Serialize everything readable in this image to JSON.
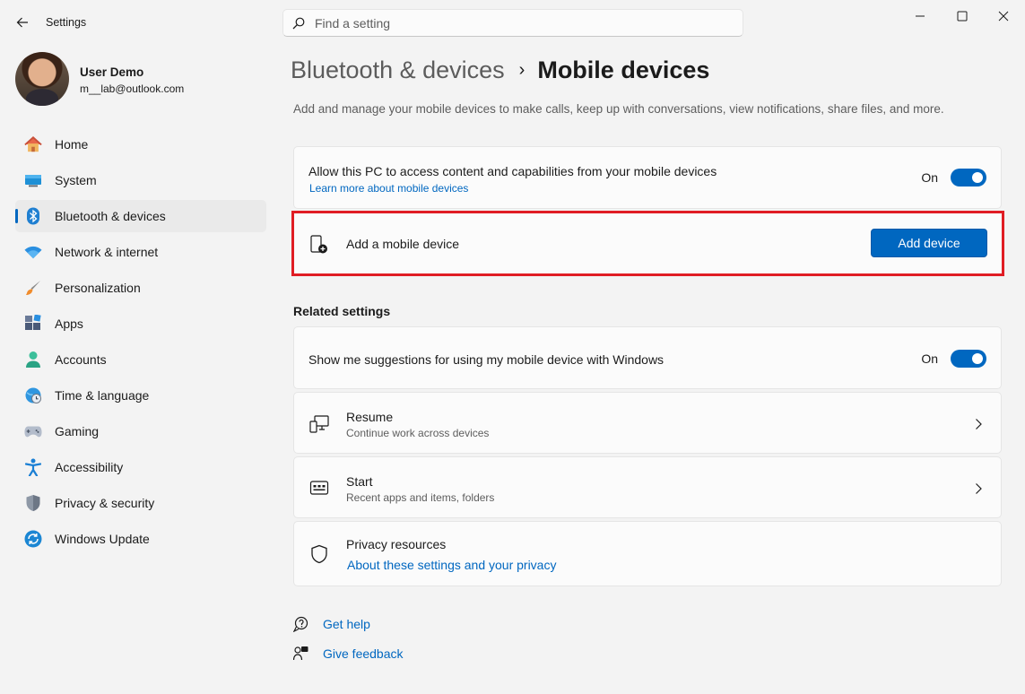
{
  "window": {
    "app_title": "Settings"
  },
  "search": {
    "placeholder": "Find a setting"
  },
  "profile": {
    "name": "User Demo",
    "email": "m__lab@outlook.com"
  },
  "sidebar": {
    "items": [
      {
        "label": "Home",
        "icon": "home-icon"
      },
      {
        "label": "System",
        "icon": "system-icon"
      },
      {
        "label": "Bluetooth & devices",
        "icon": "bluetooth-icon",
        "active": true
      },
      {
        "label": "Network & internet",
        "icon": "wifi-icon"
      },
      {
        "label": "Personalization",
        "icon": "brush-icon"
      },
      {
        "label": "Apps",
        "icon": "apps-icon"
      },
      {
        "label": "Accounts",
        "icon": "accounts-icon"
      },
      {
        "label": "Time & language",
        "icon": "globe-clock-icon"
      },
      {
        "label": "Gaming",
        "icon": "gamepad-icon"
      },
      {
        "label": "Accessibility",
        "icon": "accessibility-icon"
      },
      {
        "label": "Privacy & security",
        "icon": "shield-icon"
      },
      {
        "label": "Windows Update",
        "icon": "update-icon"
      }
    ]
  },
  "header": {
    "breadcrumb_parent": "Bluetooth & devices",
    "breadcrumb_separator": "›",
    "title": "Mobile devices",
    "description": "Add and manage your mobile devices to make calls, keep up with conversations, view notifications, share files, and more."
  },
  "main": {
    "access": {
      "title": "Allow this PC to access content and capabilities from your mobile devices",
      "link": "Learn more about mobile devices",
      "toggle_state": "On",
      "enabled": true
    },
    "add_device": {
      "title": "Add a mobile device",
      "button": "Add device"
    },
    "related_title": "Related settings",
    "suggestions": {
      "title": "Show me suggestions for using my mobile device with Windows",
      "toggle_state": "On",
      "enabled": true
    },
    "resume": {
      "title": "Resume",
      "subtitle": "Continue work across devices"
    },
    "start": {
      "title": "Start",
      "subtitle": "Recent apps and items, folders"
    },
    "privacy": {
      "title": "Privacy resources",
      "link": "About these settings and your privacy"
    }
  },
  "footer": {
    "help": "Get help",
    "feedback": "Give feedback"
  },
  "colors": {
    "accent": "#0067c0",
    "highlight": "#e01d24",
    "background": "#f3f3f3",
    "card": "#fbfbfb"
  }
}
